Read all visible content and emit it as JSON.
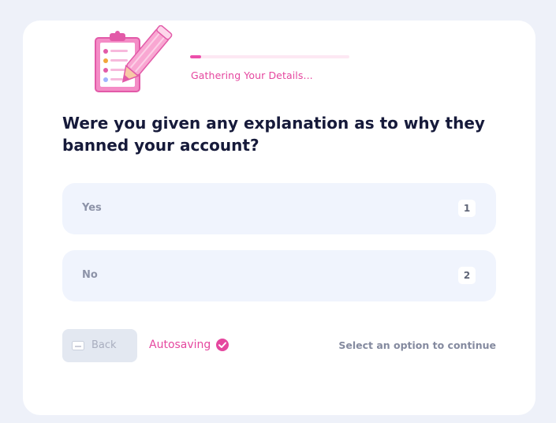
{
  "progress": {
    "label": "Gathering Your Details...",
    "fraction": 0.07
  },
  "question": {
    "text": "Were you given any explanation as to why they banned your account?"
  },
  "options": [
    {
      "label": "Yes",
      "key": "1"
    },
    {
      "label": "No",
      "key": "2"
    }
  ],
  "footer": {
    "back_label": "Back",
    "autosave_label": "Autosaving",
    "hint": "Select an option to continue"
  },
  "colors": {
    "accent": "#ec4fab",
    "heading": "#161a3a",
    "option_bg": "#f0f4fd",
    "page_bg": "#eef1f9"
  },
  "icons": {
    "illustration": "clipboard-pencil-icon",
    "back": "keyboard-key-icon",
    "autosave": "check-circle-icon"
  }
}
